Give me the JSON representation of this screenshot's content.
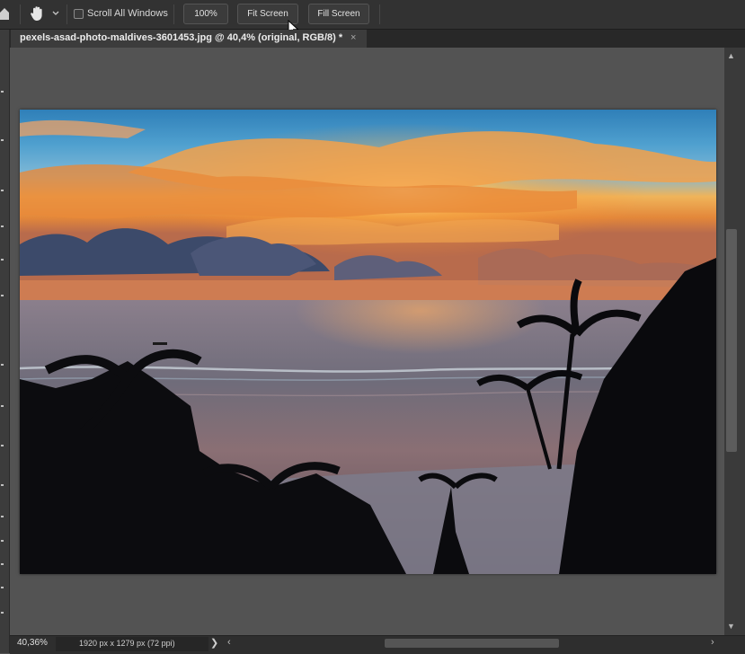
{
  "options_bar": {
    "scroll_all_windows_label": "Scroll All Windows",
    "scroll_all_windows_checked": false,
    "btn_100_label": "100%",
    "fit_screen_label": "Fit Screen",
    "fill_screen_label": "Fill Screen",
    "icons": [
      "home-icon",
      "hand-icon",
      "chevron-down-icon",
      "cursor-icon"
    ]
  },
  "document_tab": {
    "title": "pexels-asad-photo-maldives-3601453.jpg @ 40,4% (original, RGB/8) *",
    "close_glyph": "×"
  },
  "status_bar": {
    "zoom": "40,36%",
    "doc_info": "1920 px x 1279 px (72 ppi)",
    "chevron_glyph": "❯",
    "scroll_left_glyph": "‹",
    "scroll_right_glyph": "›"
  },
  "scrollbar": {
    "up_glyph": "▲",
    "down_glyph": "▼"
  },
  "colors": {
    "app_bg": "#535353",
    "toolbar_bg": "#323232",
    "tab_active_bg": "#3c3c3c",
    "sunset_orange": "#f29a3a",
    "sky_blue": "#3f8fc4"
  }
}
